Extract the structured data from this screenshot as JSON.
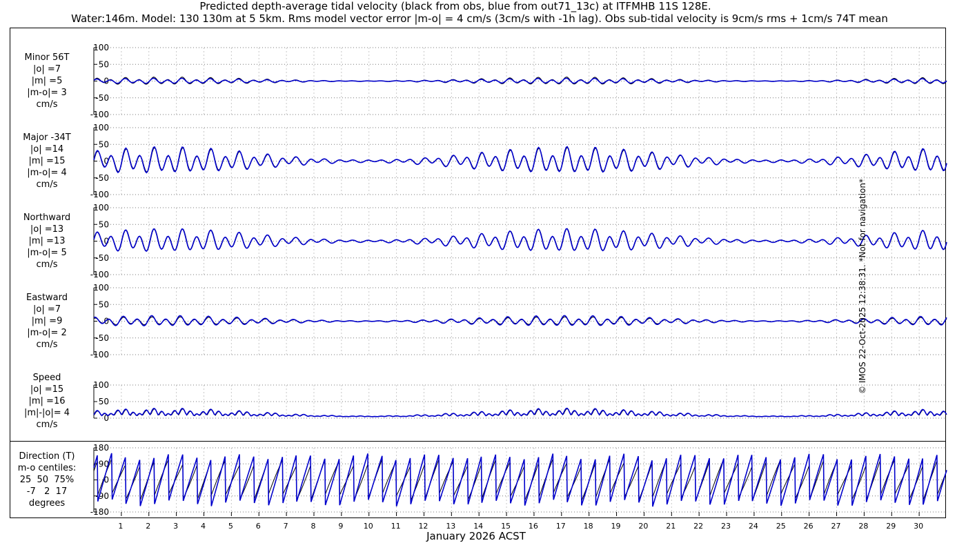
{
  "title_line1": "Predicted depth-average tidal velocity (black from obs, blue from out71_13c) at ITFMHB 11S 128E.",
  "title_line2": "Water:146m. Model: 130 130m at 5 5km. Rms model vector error |m-o| = 4 cm/s (3cm/s with -1h lag). Obs sub-tidal velocity is 9cm/s rms + 1cm/s 74T mean",
  "side_note": "© IMOS 22-Oct-2025 12:38:31. *Not for navigation*",
  "x_axis_label": "January 2026 ACST",
  "colors": {
    "obs": "#000000",
    "model": "#0000cc",
    "grid": "#999999"
  },
  "chart_data": [
    {
      "type": "line",
      "panel": "minor",
      "label_lines": [
        "Minor 56T",
        "|o| =7",
        "|m| =5",
        "|m-o|= 3",
        "cm/s"
      ],
      "yticks": [
        -100,
        -50,
        0,
        50,
        100
      ],
      "ylim": [
        -100,
        100
      ],
      "amplitude": {
        "obs": 7,
        "model": 5
      },
      "series": []
    },
    {
      "type": "line",
      "panel": "major",
      "label_lines": [
        "Major -34T",
        "|o| =14",
        "|m| =15",
        "|m-o|= 4",
        "cm/s"
      ],
      "yticks": [
        -100,
        -50,
        0,
        50,
        100
      ],
      "ylim": [
        -100,
        100
      ],
      "amplitude": {
        "obs": 14,
        "model": 15
      },
      "series": []
    },
    {
      "type": "line",
      "panel": "northward",
      "label_lines": [
        "Northward",
        "|o| =13",
        "|m| =13",
        "|m-o|= 5",
        "cm/s"
      ],
      "yticks": [
        -100,
        -50,
        0,
        50,
        100
      ],
      "ylim": [
        -100,
        100
      ],
      "amplitude": {
        "obs": 13,
        "model": 13
      },
      "series": []
    },
    {
      "type": "line",
      "panel": "eastward",
      "label_lines": [
        "Eastward",
        "|o| =7",
        "|m| =9",
        "|m-o|= 2",
        "cm/s"
      ],
      "yticks": [
        -100,
        -50,
        0,
        50,
        100
      ],
      "ylim": [
        -100,
        100
      ],
      "amplitude": {
        "obs": 7,
        "model": 9
      },
      "series": []
    },
    {
      "type": "line",
      "panel": "speed",
      "label_lines": [
        "Speed",
        "|o| =15",
        "|m| =16",
        "|m|-|o|= 4",
        "cm/s"
      ],
      "yticks": [
        0,
        50,
        100
      ],
      "ylim": [
        0,
        100
      ],
      "amplitude": {
        "obs": 15,
        "model": 16
      },
      "series": []
    },
    {
      "type": "line",
      "panel": "direction",
      "label_lines": [
        "Direction (T)",
        "m-o centiles:",
        "25  50  75%",
        "-7   2  17",
        "degrees"
      ],
      "yticks": [
        -180,
        -90,
        0,
        90,
        180
      ],
      "ylim": [
        -180,
        180
      ],
      "series": []
    }
  ],
  "x_axis": {
    "tick_labels": [
      "1",
      "2",
      "3",
      "4",
      "5",
      "6",
      "7",
      "8",
      "9",
      "10",
      "11",
      "12",
      "13",
      "14",
      "15",
      "16",
      "17",
      "18",
      "19",
      "20",
      "21",
      "22",
      "23",
      "24",
      "25",
      "26",
      "27",
      "28",
      "29",
      "30"
    ],
    "xlim_days": [
      0,
      31
    ]
  }
}
